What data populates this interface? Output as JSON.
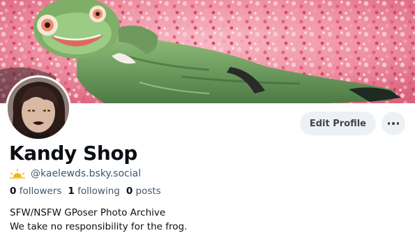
{
  "banner": {
    "icon": "flower-field-frog-banner"
  },
  "avatar": {
    "icon": "avatar-portrait"
  },
  "actions": {
    "edit_profile_label": "Edit Profile",
    "more_icon": "ellipsis-icon"
  },
  "profile": {
    "display_name": "Kandy Shop",
    "handle": "@kaelewds.bsky.social",
    "handle_icon": "sunrise-icon",
    "handle_icon_color": "#f2b418"
  },
  "stats": {
    "followers_count": "0",
    "followers_label": "followers",
    "following_count": "1",
    "following_label": "following",
    "posts_count": "0",
    "posts_label": "posts"
  },
  "bio": {
    "line1": "SFW/NSFW GPoser Photo Archive",
    "line2": "We take no responsibility for the frog."
  },
  "colors": {
    "text_primary": "#0b0f14",
    "text_secondary": "#42576c",
    "button_bg": "#eef1f4",
    "banner_pink": "#f3a6b5",
    "outfit_green": "#6f9a5e"
  }
}
